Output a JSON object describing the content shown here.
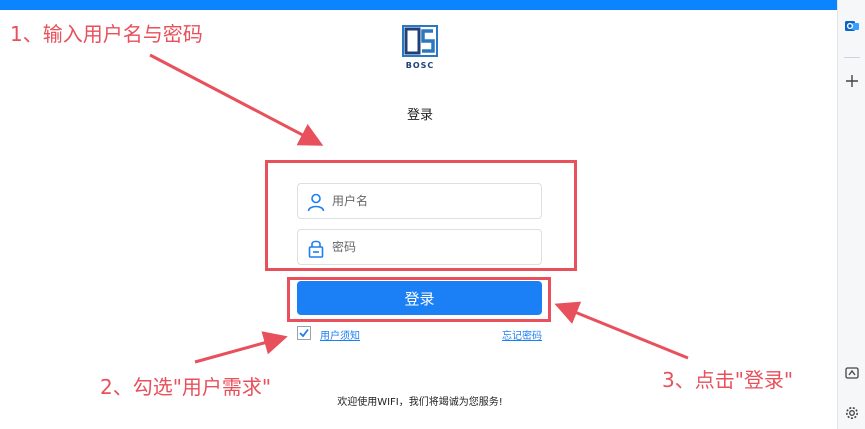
{
  "colors": {
    "accent": "#1b7ff5",
    "annotation": "#e8505b",
    "topbar": "#0a84ff"
  },
  "logo": {
    "icon": "bosc-logo-icon",
    "text": "BOSC"
  },
  "page_title": "登录",
  "form": {
    "username": {
      "placeholder": "用户名",
      "value": "",
      "icon": "user-icon"
    },
    "password": {
      "placeholder": "密码",
      "value": "",
      "icon": "lock-icon"
    },
    "login_button": "登录",
    "agree": {
      "checked": true,
      "label": "用户须知"
    },
    "forgot_password": "忘记密码"
  },
  "welcome_text": "欢迎使用WIFI，我们将竭诚为您服务!",
  "annotations": {
    "step1": "1、输入用户名与密码",
    "step2": "2、勾选\"用户需求\"",
    "step3": "3、点击\"登录\""
  },
  "sidebar_icons": [
    "outlook-icon",
    "plus-icon",
    "screenshot-icon",
    "gear-icon"
  ]
}
